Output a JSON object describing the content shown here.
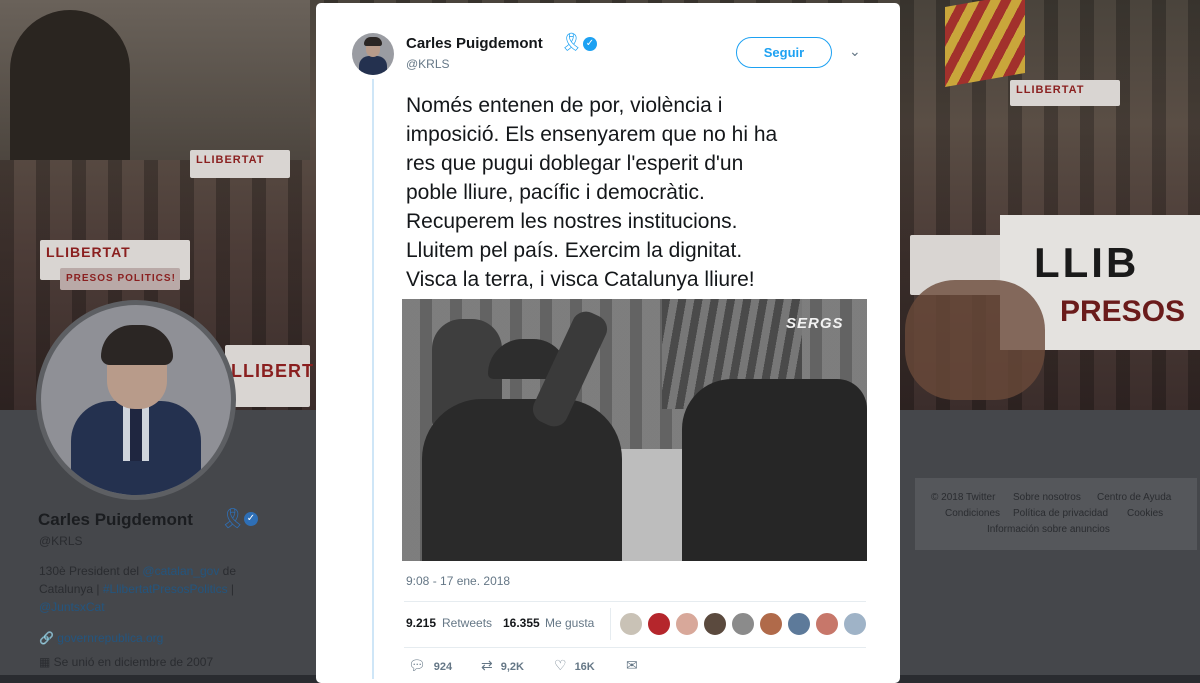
{
  "background_profile": {
    "banner_signs": [
      "LLIBERTAT",
      "PRESOS POLITICS!",
      "LLIBERTAT",
      "LLIBERT",
      "LLIB",
      "PRESOS"
    ],
    "name": "Carles Puigdemont",
    "handle": "@KRLS",
    "bio_prefix": "130è President del",
    "bio_link1": "@catalan_gov",
    "bio_mid": "de Catalunya |",
    "bio_link2": "#LlibertatPresosPolitics",
    "bio_sep": "|",
    "bio_link3": "@JuntsxCat",
    "url": "governrepublica.org",
    "joined": "Se unió en diciembre de 2007",
    "footer": {
      "l1": "© 2018 Twitter",
      "l2": "Sobre nosotros",
      "l3": "Centro de Ayuda",
      "l4": "Condiciones",
      "l5": "Política de privacidad",
      "l6": "Cookies",
      "l7": "Información sobre anuncios"
    }
  },
  "tweet": {
    "author_name": "Carles Puigdemont",
    "author_handle": "@KRLS",
    "follow_label": "Seguir",
    "text": "Només entenen de por, violència i\nimposició. Els ensenyarem que no hi ha\nres que pugui doblegar l'esperit d'un\npoble lliure, pacífic i democràtic.\nRecuperem les nostres institucions.\nLluitem pel país. Exercim la dignitat.\nVisca la terra, i visca Catalunya lliure!",
    "media_watermark": "SERGS",
    "timestamp": "9:08 - 17 ene. 2018",
    "retweets_count": "9.215",
    "retweets_label": "Retweets",
    "likes_count": "16.355",
    "likes_label": "Me gusta",
    "liker_colors": [
      "#c9c2b6",
      "#b5262c",
      "#d8a89a",
      "#5b4a3e",
      "#8b8b8b",
      "#b06a4a",
      "#5d7a9a",
      "#c7776a",
      "#9fb3c7"
    ],
    "actions": {
      "reply_count": "924",
      "retweet_count": "9,2K",
      "like_count": "16K"
    }
  },
  "colors": {
    "accent": "#1da1f2",
    "text": "#14171a",
    "muted": "#657786"
  }
}
